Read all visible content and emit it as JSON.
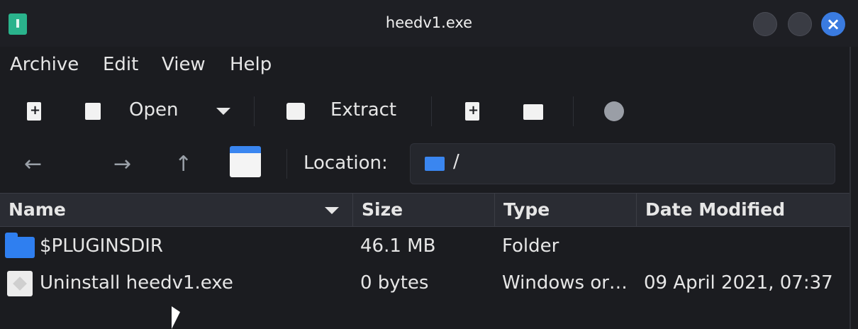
{
  "window": {
    "title": "heedv1.exe"
  },
  "menu": [
    "Archive",
    "Edit",
    "View",
    "Help"
  ],
  "toolbar": {
    "open_label": "Open",
    "extract_label": "Extract"
  },
  "location": {
    "label": "Location:",
    "path": "/"
  },
  "columns": [
    "Name",
    "Size",
    "Type",
    "Date Modified"
  ],
  "rows": [
    {
      "name": "$PLUGINSDIR",
      "size": "46.1 MB",
      "type": "Folder",
      "date": ""
    },
    {
      "name": "Uninstall heedv1.exe",
      "size": "0 bytes",
      "type": "Windows or…",
      "date": "09 April 2021, 07:37"
    }
  ],
  "colors": {
    "accent": "#3a7be0",
    "folder": "#2f7ff0",
    "background": "#1b1c20"
  }
}
